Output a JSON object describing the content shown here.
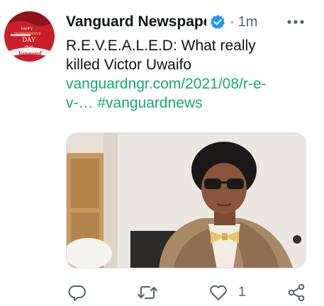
{
  "tweet": {
    "display_name": "Vanguard Newspapers",
    "time_separator": "·",
    "timestamp": "1m",
    "text_line1": "R.E.V.E.A.L.E.D: What really",
    "text_line2": "killed Victor Uwaifo",
    "link_line1": "vanguardngr.com/2021/08/r-e-",
    "link_line2_url": "v-…",
    "hashtag": "#vanguardnews",
    "avatar_text_top": "HAPPY",
    "avatar_text_mid": "INDEPENDENCE",
    "avatar_text_day": "DAY",
    "avatar_text_from": "FROM",
    "avatar_text_brand": "Vanguard"
  },
  "actions": {
    "reply_icon": "reply-icon",
    "retweet_icon": "retweet-icon",
    "like_icon": "heart-icon",
    "like_count": "1",
    "share_icon": "share-icon"
  },
  "colors": {
    "link": "#17a673",
    "verified": "#1d9bf0",
    "meta": "#536471",
    "avatar_bg": "#c8202a"
  }
}
